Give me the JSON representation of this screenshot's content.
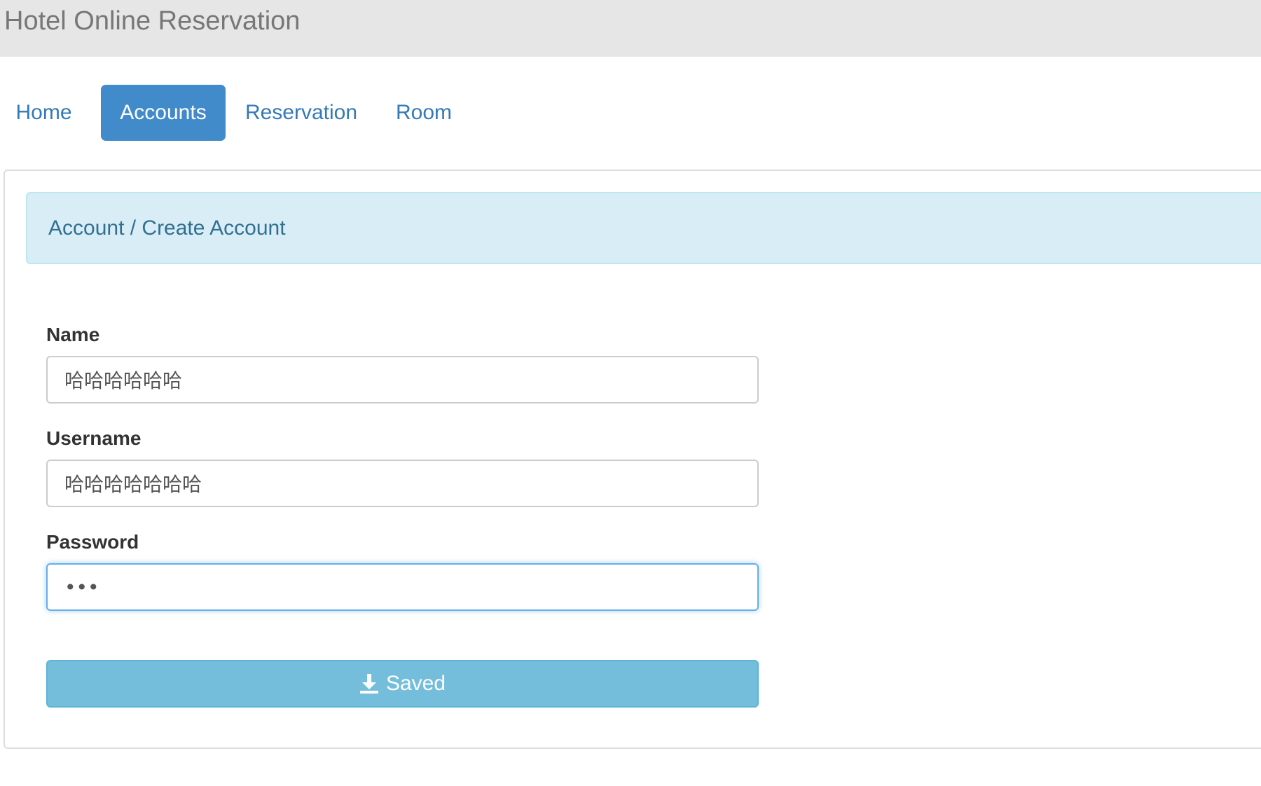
{
  "header": {
    "title": "Hotel Online Reservation"
  },
  "nav": {
    "tabs": [
      {
        "label": "Home",
        "active": false
      },
      {
        "label": "Accounts",
        "active": true
      },
      {
        "label": "Reservation",
        "active": false
      },
      {
        "label": "Room",
        "active": false
      }
    ]
  },
  "breadcrumb": {
    "text": "Account / Create Account"
  },
  "form": {
    "name_label": "Name",
    "name_value": "哈哈哈哈哈哈",
    "username_label": "Username",
    "username_value": "哈哈哈哈哈哈哈",
    "password_label": "Password",
    "password_value": "abc",
    "save_label": "Saved"
  },
  "icons": {
    "save_icon": "download-icon"
  },
  "colors": {
    "header_bg": "#e6e6e6",
    "active_tab": "#428bca",
    "link": "#337ab7",
    "breadcrumb_bg": "#d9edf7",
    "breadcrumb_text": "#31708f",
    "button_bg": "#75bedb",
    "focus_border": "#66afe9"
  }
}
